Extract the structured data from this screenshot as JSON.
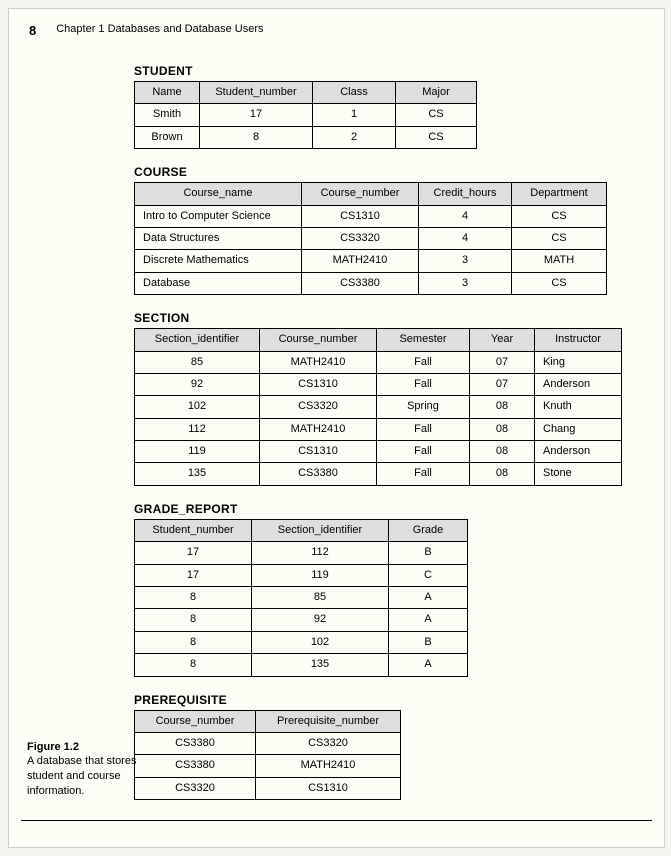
{
  "page_number": "8",
  "chapter_header": "Chapter 1  Databases and Database Users",
  "tables": {
    "student": {
      "title": "STUDENT",
      "headers": [
        "Name",
        "Student_number",
        "Class",
        "Major"
      ],
      "rows": [
        [
          "Smith",
          "17",
          "1",
          "CS"
        ],
        [
          "Brown",
          "8",
          "2",
          "CS"
        ]
      ]
    },
    "course": {
      "title": "COURSE",
      "headers": [
        "Course_name",
        "Course_number",
        "Credit_hours",
        "Department"
      ],
      "rows": [
        [
          "Intro to Computer Science",
          "CS1310",
          "4",
          "CS"
        ],
        [
          "Data Structures",
          "CS3320",
          "4",
          "CS"
        ],
        [
          "Discrete Mathematics",
          "MATH2410",
          "3",
          "MATH"
        ],
        [
          "Database",
          "CS3380",
          "3",
          "CS"
        ]
      ]
    },
    "section": {
      "title": "SECTION",
      "headers": [
        "Section_identifier",
        "Course_number",
        "Semester",
        "Year",
        "Instructor"
      ],
      "rows": [
        [
          "85",
          "MATH2410",
          "Fall",
          "07",
          "King"
        ],
        [
          "92",
          "CS1310",
          "Fall",
          "07",
          "Anderson"
        ],
        [
          "102",
          "CS3320",
          "Spring",
          "08",
          "Knuth"
        ],
        [
          "112",
          "MATH2410",
          "Fall",
          "08",
          "Chang"
        ],
        [
          "119",
          "CS1310",
          "Fall",
          "08",
          "Anderson"
        ],
        [
          "135",
          "CS3380",
          "Fall",
          "08",
          "Stone"
        ]
      ]
    },
    "grade": {
      "title": "GRADE_REPORT",
      "headers": [
        "Student_number",
        "Section_identifier",
        "Grade"
      ],
      "rows": [
        [
          "17",
          "112",
          "B"
        ],
        [
          "17",
          "119",
          "C"
        ],
        [
          "8",
          "85",
          "A"
        ],
        [
          "8",
          "92",
          "A"
        ],
        [
          "8",
          "102",
          "B"
        ],
        [
          "8",
          "135",
          "A"
        ]
      ]
    },
    "prereq": {
      "title": "PREREQUISITE",
      "headers": [
        "Course_number",
        "Prerequisite_number"
      ],
      "rows": [
        [
          "CS3380",
          "CS3320"
        ],
        [
          "CS3380",
          "MATH2410"
        ],
        [
          "CS3320",
          "CS1310"
        ]
      ]
    }
  },
  "figure": {
    "label": "Figure 1.2",
    "caption": "A database that stores student and course information."
  }
}
